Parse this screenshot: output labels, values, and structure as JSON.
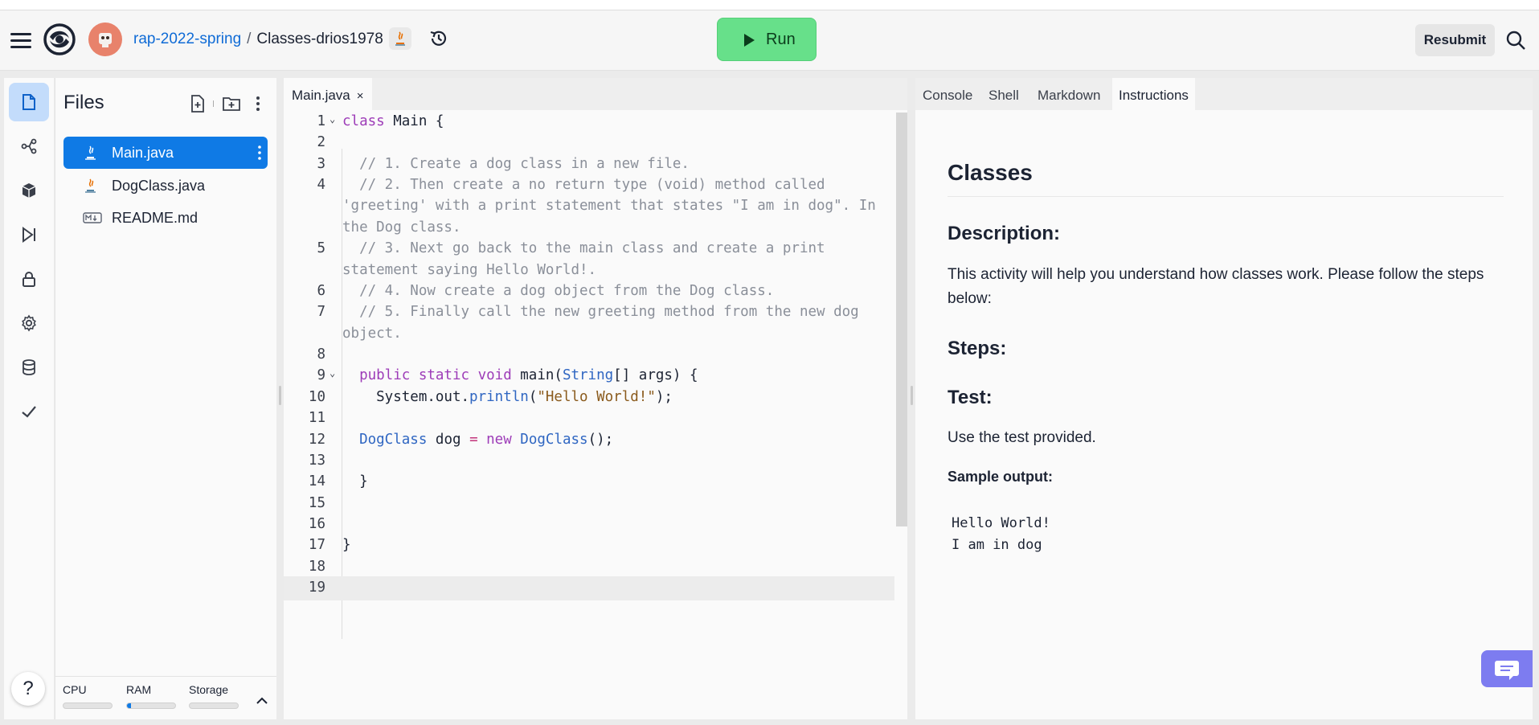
{
  "header": {
    "team": "rap-2022-spring",
    "separator": "/",
    "repl_name": "Classes-drios1978",
    "run_label": "Run",
    "resubmit_label": "Resubmit"
  },
  "files_panel": {
    "title": "Files",
    "files": [
      {
        "name": "Main.java",
        "icon": "java-icon",
        "active": true
      },
      {
        "name": "DogClass.java",
        "icon": "java-icon",
        "active": false
      },
      {
        "name": "README.md",
        "icon": "markdown-icon",
        "active": false
      }
    ],
    "resources": {
      "cpu_label": "CPU",
      "ram_label": "RAM",
      "storage_label": "Storage",
      "cpu_usage": 0,
      "ram_usage": 0.08,
      "storage_usage": 0
    }
  },
  "editor": {
    "tab_label": "Main.java",
    "tab_close": "×",
    "lines": [
      {
        "n": "1",
        "fold": "⌄"
      },
      {
        "n": "2"
      },
      {
        "n": "3"
      },
      {
        "n": "4"
      },
      {
        "n": "5"
      },
      {
        "n": "6"
      },
      {
        "n": "7"
      },
      {
        "n": "8"
      },
      {
        "n": "9",
        "fold": "⌄"
      },
      {
        "n": "10"
      },
      {
        "n": "11"
      },
      {
        "n": "12"
      },
      {
        "n": "13"
      },
      {
        "n": "14"
      },
      {
        "n": "15"
      },
      {
        "n": "16"
      },
      {
        "n": "17"
      },
      {
        "n": "18"
      },
      {
        "n": "19"
      }
    ],
    "code": {
      "l1_kw": "class",
      "l1_rest": " Main {",
      "l3": "  // 1. Create a dog class in a new file.",
      "l4a": "  // 2. Then create a no return type (void) method called",
      "l4b": "'greeting' with a print statement that states \"I am in dog\". In",
      "l4c": "the Dog class.",
      "l5a": "  // 3. Next go back to the main class and create a print",
      "l5b": "statement saying Hello World!.",
      "l6": "  // 4. Now create a dog object from the Dog class.",
      "l7a": "  // 5. Finally call the new greeting method from the new dog",
      "l7b": "object.",
      "l9_indent": "  ",
      "l9_kw": "public static void",
      "l9_mid": " main(",
      "l9_type": "String",
      "l9_end": "[] args) {",
      "l10_pre": "    System.out.",
      "l10_fn": "println",
      "l10_open": "(",
      "l10_str": "\"Hello World!\"",
      "l10_close": ");",
      "l12_indent": "  ",
      "l12_type": "DogClass",
      "l12_var": " dog ",
      "l12_eq": "=",
      "l12_new": " new",
      "l12_type2": " DogClass",
      "l12_end": "();",
      "l14": "  }",
      "l17": "}"
    }
  },
  "right_panel": {
    "tabs": [
      "Console",
      "Shell",
      "Markdown",
      "Instructions"
    ],
    "active_tab": "Instructions",
    "title": "Classes",
    "description_heading": "Description:",
    "description_text": "This activity will help you understand how classes work. Please follow the steps below:",
    "steps_heading": "Steps:",
    "test_heading": "Test:",
    "test_text": "Use the test provided.",
    "sample_heading": "Sample output:",
    "sample_output": "Hello World!\nI am in dog"
  },
  "help_label": "?",
  "colors": {
    "accent": "#0f7ae5",
    "run_green": "#67e08a",
    "active_file_bg": "#0f7ae5",
    "chat_purple": "#7d7cf0"
  }
}
